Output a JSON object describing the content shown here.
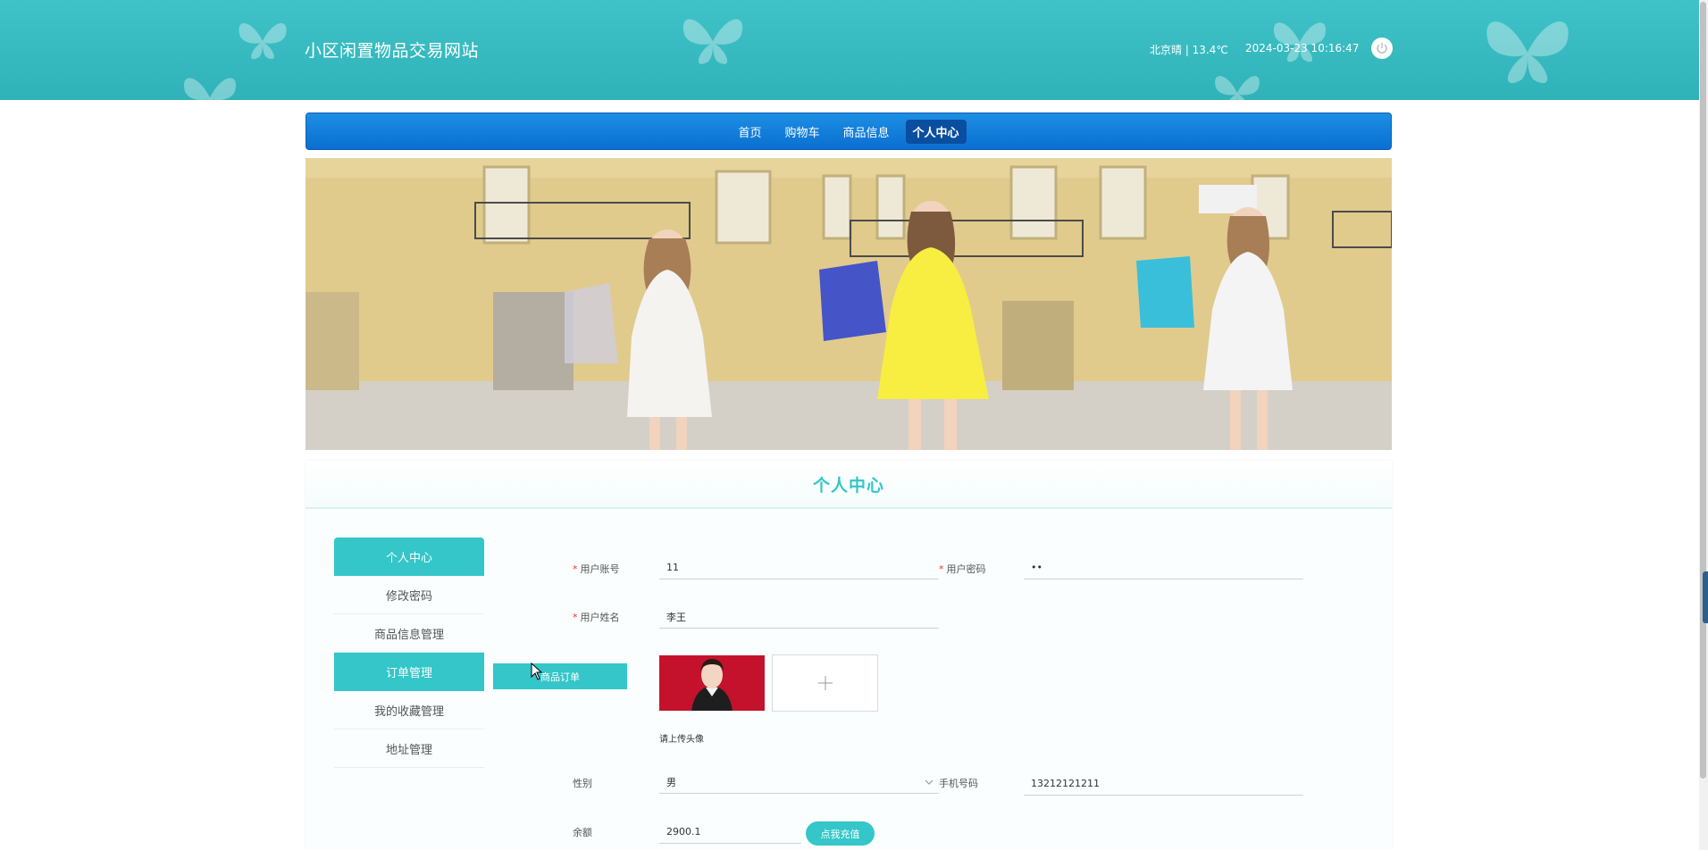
{
  "header": {
    "site_title": "小区闲置物品交易网站",
    "weather": "北京晴 | 13.4℃",
    "datetime": "2024-03-23  10:16:47"
  },
  "nav": {
    "items": [
      {
        "label": "首页",
        "active": false
      },
      {
        "label": "购物车",
        "active": false
      },
      {
        "label": "商品信息",
        "active": false
      },
      {
        "label": "个人中心",
        "active": true
      }
    ]
  },
  "panel": {
    "title": "个人中心",
    "side_menu": [
      {
        "label": "个人中心",
        "active": true
      },
      {
        "label": "修改密码",
        "active": false
      },
      {
        "label": "商品信息管理",
        "active": false
      },
      {
        "label": "订单管理",
        "active": true
      },
      {
        "label": "我的收藏管理",
        "active": false
      },
      {
        "label": "地址管理",
        "active": false
      }
    ],
    "sub_menu_label": "商品订单"
  },
  "form": {
    "account_label": "用户账号",
    "account_value": "11",
    "password_label": "用户密码",
    "password_value": "••",
    "name_label": "用户姓名",
    "name_value": "李王",
    "upload_hint": "请上传头像",
    "gender_label": "性别",
    "gender_value": "男",
    "phone_label": "手机号码",
    "phone_value": "13212121211",
    "balance_label": "余额",
    "balance_value": "2900.1",
    "recharge_label": "点我充值"
  },
  "colors": {
    "header_teal": "#3fc3c8",
    "nav_blue": "#0a6fd1",
    "accent_teal": "#34c6c9",
    "required_star": "#e33333"
  }
}
